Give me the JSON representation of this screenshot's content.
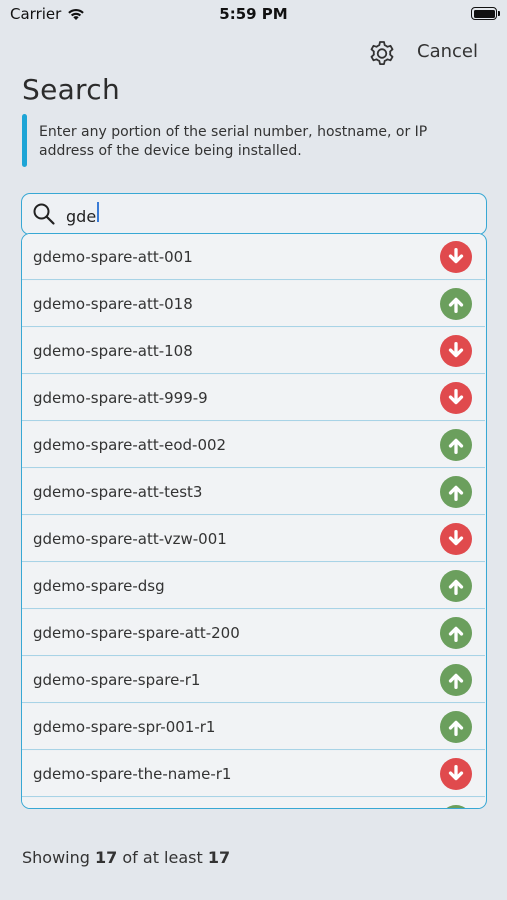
{
  "status_bar": {
    "carrier": "Carrier",
    "time": "5:59 PM"
  },
  "header": {
    "settings_icon": "gear-icon",
    "cancel_label": "Cancel",
    "title": "Search"
  },
  "help": {
    "text": "Enter any portion of the serial number, hostname, or IP address of the device being installed."
  },
  "search": {
    "icon": "search-icon",
    "value": "gde"
  },
  "results": [
    {
      "name": "gdemo-spare-att-001",
      "status": "down"
    },
    {
      "name": "gdemo-spare-att-018",
      "status": "up"
    },
    {
      "name": "gdemo-spare-att-108",
      "status": "down"
    },
    {
      "name": "gdemo-spare-att-999-9",
      "status": "down"
    },
    {
      "name": "gdemo-spare-att-eod-002",
      "status": "up"
    },
    {
      "name": "gdemo-spare-att-test3",
      "status": "up"
    },
    {
      "name": "gdemo-spare-att-vzw-001",
      "status": "down"
    },
    {
      "name": "gdemo-spare-dsg",
      "status": "up"
    },
    {
      "name": "gdemo-spare-spare-att-200",
      "status": "up"
    },
    {
      "name": "gdemo-spare-spare-r1",
      "status": "up"
    },
    {
      "name": "gdemo-spare-spr-001-r1",
      "status": "up"
    },
    {
      "name": "gdemo-spare-the-name-r1",
      "status": "down"
    },
    {
      "name": "",
      "status": "up"
    }
  ],
  "status_colors": {
    "up": "#6b9f5d",
    "down": "#e04a4d"
  },
  "footer": {
    "prefix": "Showing",
    "shown": "17",
    "middle": "of at least",
    "total": "17"
  }
}
